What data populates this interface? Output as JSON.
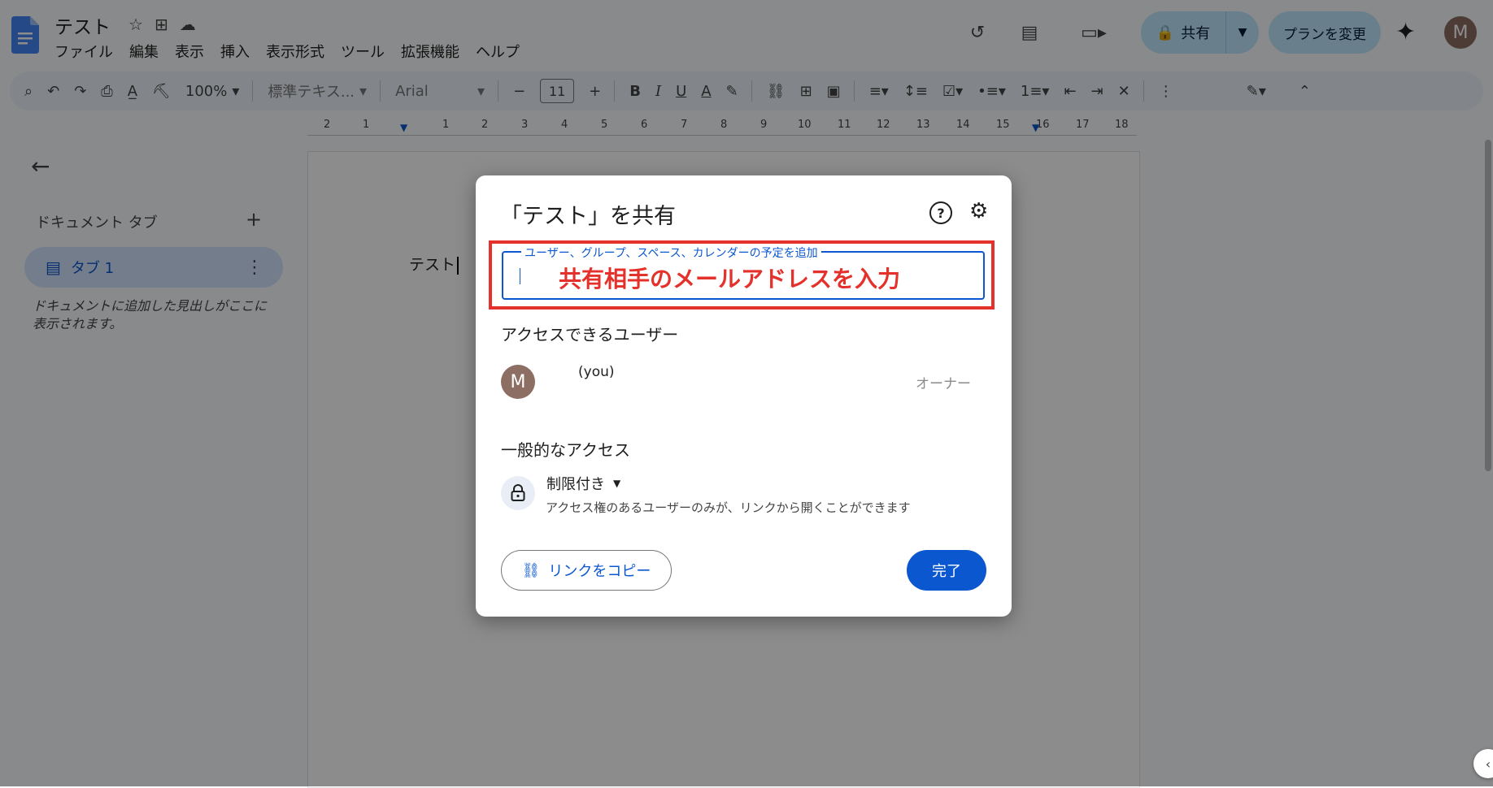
{
  "header": {
    "doc_title": "テスト",
    "menu": [
      "ファイル",
      "編集",
      "表示",
      "挿入",
      "表示形式",
      "ツール",
      "拡張機能",
      "ヘルプ"
    ],
    "share_label": "共有",
    "plan_label": "プランを変更",
    "avatar_letter": "M"
  },
  "toolbar": {
    "zoom": "100%",
    "style": "標準テキス...",
    "font": "Arial",
    "font_size": "11"
  },
  "ruler": [
    "2",
    "1",
    "1",
    "2",
    "3",
    "4",
    "5",
    "6",
    "7",
    "8",
    "9",
    "10",
    "11",
    "12",
    "13",
    "14",
    "15",
    "16",
    "17",
    "18"
  ],
  "sidebar": {
    "heading": "ドキュメント タブ",
    "tab_label": "タブ 1",
    "note": "ドキュメントに追加した見出しがここに表示されます。"
  },
  "document": {
    "body_text": "テスト"
  },
  "dialog": {
    "title": "「テスト」を共有",
    "input_label": "ユーザー、グループ、スペース、カレンダーの予定を追加",
    "annotation": "共有相手のメールアドレスを入力",
    "access_heading": "アクセスできるユーザー",
    "user_avatar": "M",
    "user_name": "(you)",
    "user_role": "オーナー",
    "general_heading": "一般的なアクセス",
    "restriction": "制限付き",
    "restriction_desc": "アクセス権のあるユーザーのみが、リンクから開くことができます",
    "copy_link": "リンクをコピー",
    "done": "完了"
  },
  "colors": {
    "accent": "#0b57d0",
    "annotation_red": "#e4312b",
    "share_bg": "#c2e7ff"
  },
  "icons": [
    "docs-logo-icon",
    "star-icon",
    "move-folder-icon",
    "cloud-icon",
    "history-icon",
    "comment-icon",
    "meet-icon",
    "lock-icon",
    "gemini-icon",
    "search-icon",
    "undo-icon",
    "redo-icon",
    "print-icon",
    "spellcheck-icon",
    "paint-format-icon",
    "help-icon",
    "gear-icon",
    "link-icon",
    "back-arrow-icon"
  ]
}
